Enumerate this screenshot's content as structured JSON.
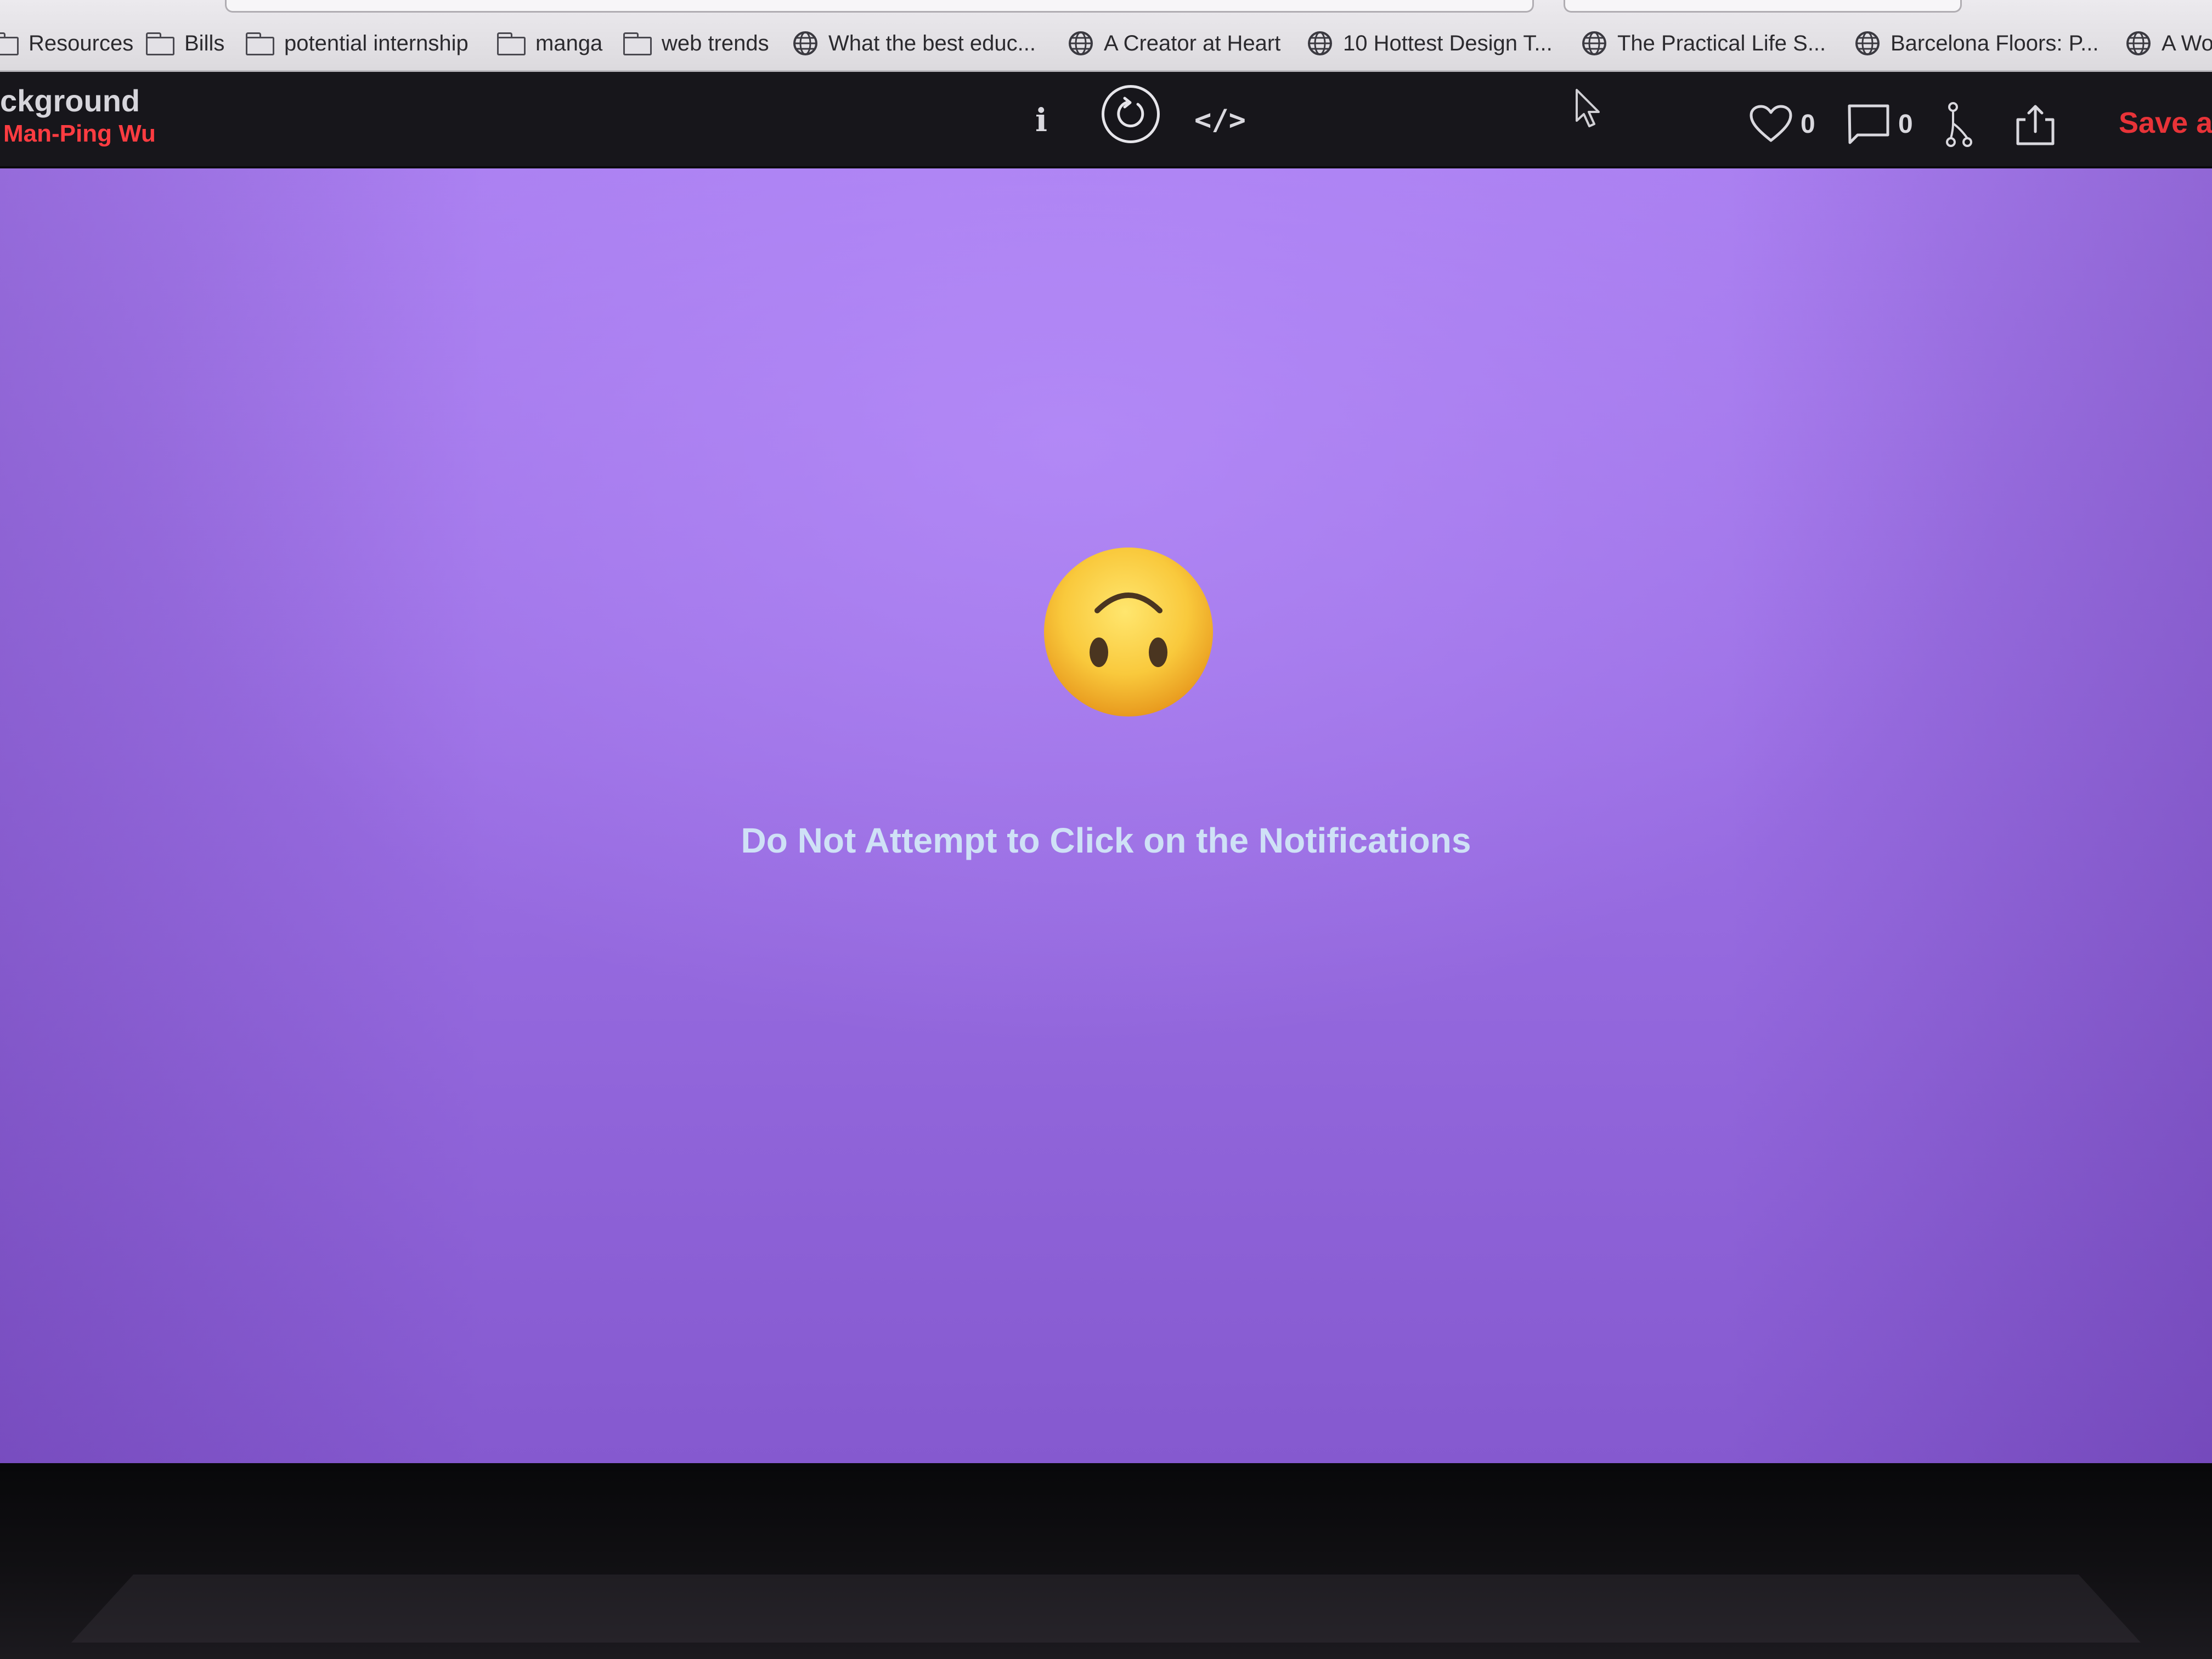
{
  "bookmarks": [
    {
      "label": "Resources",
      "icon": "folder-icon"
    },
    {
      "label": "Bills",
      "icon": "folder-icon"
    },
    {
      "label": "potential internship",
      "icon": "folder-icon"
    },
    {
      "label": "manga",
      "icon": "folder-icon"
    },
    {
      "label": "web trends",
      "icon": "folder-icon"
    },
    {
      "label": "What the best educ...",
      "icon": "globe-icon"
    },
    {
      "label": "A Creator at Heart",
      "icon": "globe-icon"
    },
    {
      "label": "10 Hottest Design T...",
      "icon": "globe-icon"
    },
    {
      "label": "The Practical Life S...",
      "icon": "globe-icon"
    },
    {
      "label": "Barcelona Floors: P...",
      "icon": "globe-icon"
    },
    {
      "label": "A Wo",
      "icon": "globe-icon"
    }
  ],
  "editor": {
    "pen_title": "ckground",
    "pen_author": "Man-Ping Wu",
    "info_label": "i",
    "code_label": "</>",
    "likes": "0",
    "comments": "0",
    "save_label": "Save as"
  },
  "preview": {
    "emoji": "upside-down-face-icon",
    "message": "Do Not Attempt to Click on the Notifications"
  },
  "colors": {
    "toolbar_bg": "#17161b",
    "author": "#ff3c41",
    "save": "#e83338",
    "preview_bg": "#9b6fe4",
    "message": "#cfe1f6"
  }
}
